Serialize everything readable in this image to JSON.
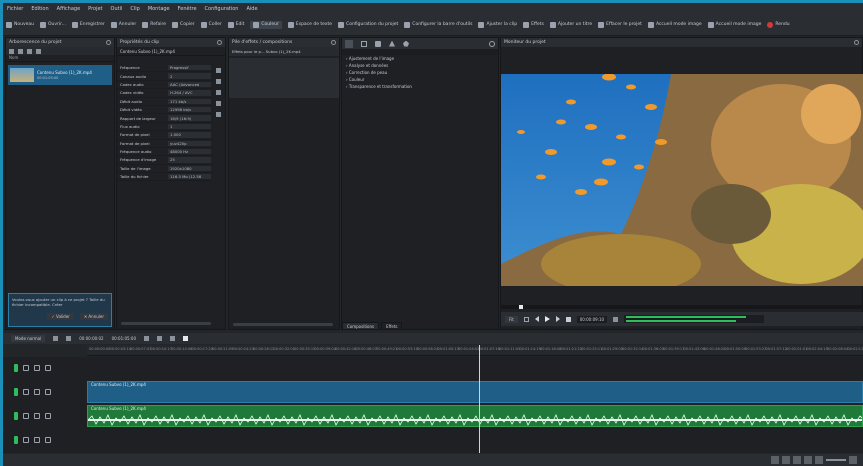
{
  "menu": [
    "Fichier",
    "Edition",
    "Affichage",
    "Projet",
    "Outil",
    "Clip",
    "Montage",
    "Fenêtre",
    "Configuration",
    "Aide"
  ],
  "toolbar": {
    "items": [
      {
        "label": "Nouveau",
        "icon": "new-file-icon"
      },
      {
        "label": "Ouvrir...",
        "icon": "open-folder-icon"
      },
      {
        "label": "Enregistrer",
        "icon": "save-icon"
      },
      {
        "label": "Annuler",
        "icon": "undo-icon"
      },
      {
        "label": "Refaire",
        "icon": "redo-icon"
      },
      {
        "label": "Copier",
        "icon": "copy-icon"
      },
      {
        "label": "Coller",
        "icon": "paste-icon"
      },
      {
        "label": "Edit",
        "icon": "edit-icon"
      },
      {
        "label": "Couleur",
        "icon": "color-icon"
      },
      {
        "label": "Espace de texte",
        "icon": "text-icon"
      },
      {
        "label": "Configuration du projet",
        "icon": "project-settings-icon"
      },
      {
        "label": "Configurer la barre d'outils",
        "icon": "toolbar-config-icon"
      },
      {
        "label": "Ajuster la clip",
        "icon": "clip-adjust-icon"
      },
      {
        "label": "Effets",
        "icon": "effects-icon"
      },
      {
        "label": "Ajouter un titre",
        "icon": "title-icon"
      },
      {
        "label": "Effacer le projet",
        "icon": "clear-icon"
      },
      {
        "label": "Accueil mode image",
        "icon": "image-mode-icon"
      },
      {
        "label": "Accueil mode image",
        "icon": "image-mode-icon"
      },
      {
        "label": "Rendu",
        "icon": "render-icon"
      }
    ]
  },
  "project_bin": {
    "title": "Arborescence du projet",
    "column": "Nom",
    "clip_name": "Contenu Subvo (1)_2K.mp4",
    "clip_sub": "00:01:05:00",
    "message": "Voulez-vous ajouter un clip à ce projet ? Taille du fichier incompatible. Créer",
    "btn_create": "✓ Valider",
    "btn_cancel": "✕ Annuler"
  },
  "clip_props": {
    "title": "Propriétés du clip",
    "file": "Contenu Subvo (1)_2K.mp4",
    "rows": [
      {
        "k": "Fréquence",
        "v": "Progressif"
      },
      {
        "k": "Canaux audio",
        "v": "2"
      },
      {
        "k": "Codec audio",
        "v": "AAC (Advanced"
      },
      {
        "k": "Codec vidéo",
        "v": "H.264 / AVC"
      },
      {
        "k": "Débit audio",
        "v": "171 kb/s"
      },
      {
        "k": "Débit vidéo",
        "v": "12998 kb/s"
      },
      {
        "k": "Rapport de largeur",
        "v": "16/9 (16:9)"
      },
      {
        "k": "Flux audio",
        "v": "1"
      },
      {
        "k": "Format de pixel",
        "v": "1.000"
      },
      {
        "k": "Format de pixel",
        "v": "yuv420p"
      },
      {
        "k": "Fréquence audio",
        "v": "48000 Hz"
      },
      {
        "k": "Fréquence d'image",
        "v": "25"
      },
      {
        "k": "Taille de l'image",
        "v": "1920x1080"
      },
      {
        "k": "Taille du fichier",
        "v": "116.5 Mo (12.58"
      }
    ]
  },
  "effects_panel": {
    "title": "Pile d'effets / compositions",
    "clip": "Effets pour le p... Subvo (1)_2K.mp4"
  },
  "effects_list": {
    "items": [
      "Ajustement de l'image",
      "Analyse et données",
      "Correction de peau",
      "Couleur",
      "Transparence et transformation"
    ],
    "tabs": [
      "Compositions",
      "Effets"
    ]
  },
  "monitor": {
    "title": "Moniteur du projet",
    "zoom": "Fit",
    "timecode": "00:00:09:10"
  },
  "timeline": {
    "mode": "Mode normal",
    "timecode_in": "00:00:00:02",
    "timecode_out": "00:01:05:00",
    "ruler": [
      "00:00:00:00",
      "00:00:03:14",
      "00:00:07:03",
      "00:00:10:17",
      "00:00:14:06",
      "00:00:17:20",
      "00:00:21:09",
      "00:00:24:23",
      "00:00:28:12",
      "00:00:32:01",
      "00:00:35:15",
      "00:00:39:04",
      "00:00:42:18",
      "00:00:46:07",
      "00:00:49:21",
      "00:00:53:10",
      "00:00:56:24",
      "00:01:00:13",
      "00:01:04:02",
      "00:01:07:16",
      "00:01:11:05",
      "00:01:14:19",
      "00:01:18:08",
      "00:01:21:22",
      "00:01:25:11",
      "00:01:29:00",
      "00:01:32:14",
      "00:01:36:03",
      "00:01:39:17",
      "00:01:43:06",
      "00:01:46:20",
      "00:01:50:09",
      "00:01:53:23",
      "00:01:57:12",
      "00:02:01:01",
      "00:02:04:15",
      "00:02:08:04",
      "00:02:11:18"
    ],
    "video_clip": "Contenu Subvo (1)_2K.mp4",
    "audio_clip": "Contenu Subvo (1)_2K.mp4"
  },
  "colors": {
    "accent": "#1a8fb8",
    "video_clip": "#1f5e86",
    "audio_clip": "#1f7a3a",
    "track_lock": "#2fbf5a"
  }
}
